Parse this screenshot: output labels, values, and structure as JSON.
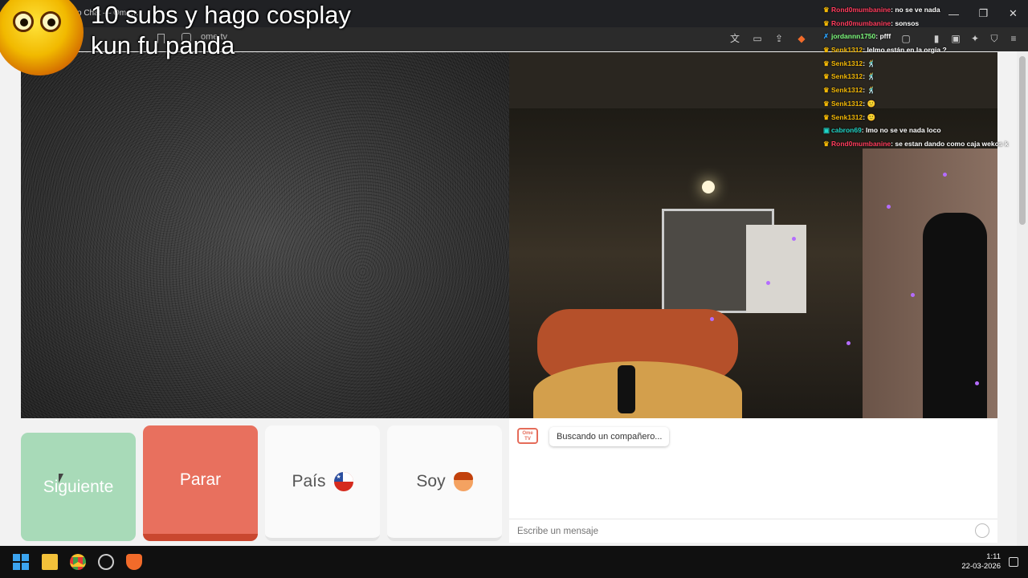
{
  "browser": {
    "tab_title": "o Chat — Ome…",
    "url": "ome.tv",
    "window": {
      "minimize": "—",
      "restore": "❐",
      "close": "✕"
    }
  },
  "overlay": {
    "line1": "10 subs y hago cosplay",
    "line2": "kun fu panda"
  },
  "stream_chat": [
    {
      "user": "Rond0mumbanine",
      "user_color": "#ff3b5c",
      "badge": "crown",
      "message": "no se ve nada"
    },
    {
      "user": "Rond0mumbanine",
      "user_color": "#ff3b5c",
      "badge": "crown",
      "message": "sonsos"
    },
    {
      "user": "jordannn1750",
      "user_color": "#7fff7f",
      "badge": "blue",
      "message": "pfff"
    },
    {
      "user": "Senk1312",
      "user_color": "#f2b705",
      "badge": "crown",
      "message": "lelmo están en la orgia ?"
    },
    {
      "user": "Senk1312",
      "user_color": "#f2b705",
      "badge": "crown",
      "message": "🕺"
    },
    {
      "user": "Senk1312",
      "user_color": "#f2b705",
      "badge": "crown",
      "message": "🕺"
    },
    {
      "user": "Senk1312",
      "user_color": "#f2b705",
      "badge": "crown",
      "message": "🕺"
    },
    {
      "user": "Senk1312",
      "user_color": "#f2b705",
      "badge": "crown",
      "message": "🙂"
    },
    {
      "user": "Senk1312",
      "user_color": "#f2b705",
      "badge": "crown",
      "message": "🙂"
    },
    {
      "user": "cabron69",
      "user_color": "#1fd3c6",
      "badge": "teal",
      "message": "lmo no se ve nada loco"
    },
    {
      "user": "Rond0mumbanine",
      "user_color": "#ff3b5c",
      "badge": "crown",
      "message": "se estan dando como caja wekos k"
    }
  ],
  "controls": {
    "next": "Siguiente",
    "stop": "Parar",
    "country": "País",
    "gender": "Soy"
  },
  "chatbox": {
    "logo": "Ome TV",
    "status": "Buscando un compañero...",
    "input_placeholder": "Escribe un mensaje"
  },
  "taskbar": {
    "time": "1:11",
    "date": "22-03-2026"
  },
  "colors": {
    "next_button": "#a8dab8",
    "stop_button": "#e8705e",
    "accent": "#e56c5a"
  }
}
